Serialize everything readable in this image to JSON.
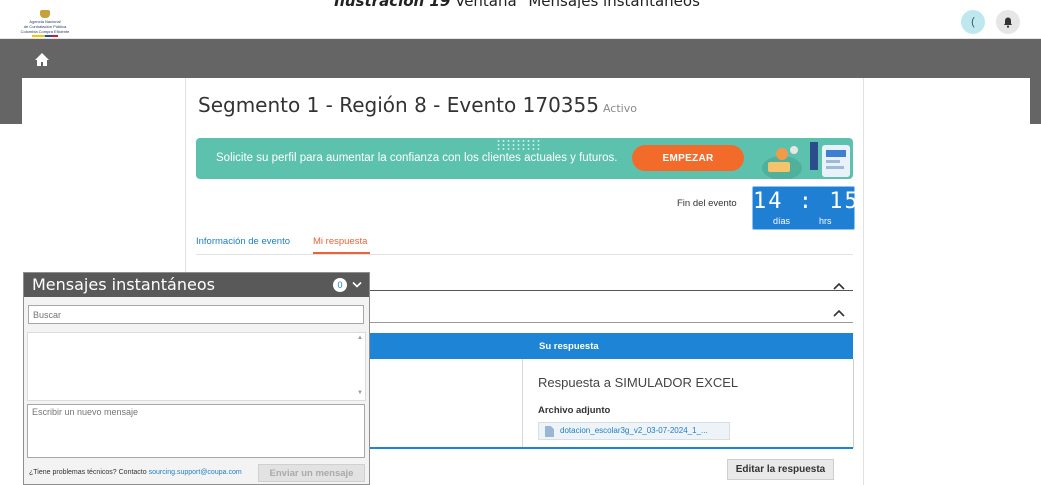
{
  "caption": {
    "bold": "Ilustración 19",
    "text": "Ventana \"Mensajes instantáneos\""
  },
  "header": {
    "logo_lines": [
      "Agencia Nacional",
      "de Contratación Pública",
      "Colombia Compra Eficiente"
    ],
    "user_initial": "(",
    "bell_icon": "bell-icon"
  },
  "nav": {
    "home_icon": "home-icon"
  },
  "event": {
    "title": "Segmento 1 - Región 8 - Evento 170355",
    "status": "Activo"
  },
  "banner": {
    "text": "Solicite su perfil para aumentar la confianza con los clientes actuales y futuros.",
    "button_label": "EMPEZAR",
    "color": "#5dc2ad",
    "button_color": "#f26b2b"
  },
  "countdown": {
    "label": "Fin del evento",
    "digits": "14 : 15",
    "days_label": "días",
    "hours_label": "hrs",
    "color": "#1e7fd3"
  },
  "tabs": [
    {
      "label": "Información de evento",
      "active": false
    },
    {
      "label": "Mi respuesta",
      "active": true
    }
  ],
  "response": {
    "header": "Su respuesta",
    "title": "Respuesta a SIMULADOR EXCEL",
    "attachment_label": "Archivo adjunto",
    "attachment_file": "dotacion_escolar3g_v2_03-07-2024_1_...",
    "edit_button": "Editar la respuesta"
  },
  "chat": {
    "title": "Mensajes instantáneos",
    "unread_count": "0",
    "search_placeholder": "Buscar",
    "message_placeholder": "Escribir un nuevo mensaje",
    "footer_text": "¿Tiene problemas técnicos? Contacto ",
    "footer_link": "sourcing.support@coupa.com",
    "send_button": "Enviar un mensaje"
  }
}
